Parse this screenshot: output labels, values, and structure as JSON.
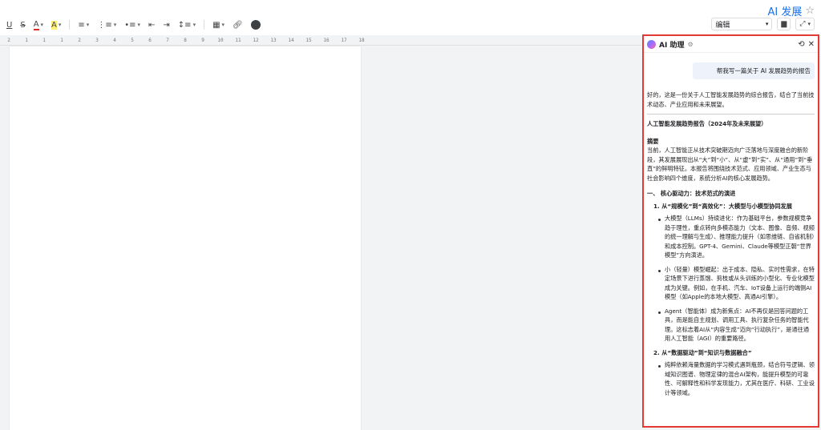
{
  "doc": {
    "title": "AI 发展",
    "mode": "编辑"
  },
  "toolbar": {
    "underline_label": "U",
    "strike_label": "S",
    "text_color_label": "A",
    "highlight_label": "A"
  },
  "ruler": [
    "2",
    "1",
    "1",
    "1",
    "2",
    "3",
    "4",
    "5",
    "6",
    "7",
    "8",
    "9",
    "10",
    "11",
    "12",
    "13",
    "14",
    "15",
    "16",
    "17",
    "18"
  ],
  "ai_panel": {
    "title": "AI 助理",
    "user_message": "帮我写一篇关于 AI 发展趋势的报告",
    "intro": "好的，这是一份关于人工智能发展趋势的综合报告，结合了当前技术动态、产业应用和未来展望。",
    "report_title": "人工智能发展趋势报告（2024年及未来展望）",
    "abstract_heading": "摘要",
    "abstract_text": "当前，人工智能正从技术突破期迈向广泛落地与深度融合的新阶段，其发展展现出从“大”到“小”、从“虚”到“实”、从“通用”到“垂直”的鲜明特征。本报告将围绕技术范式、应用领域、产业生态与社会影响四个维度，系统分析AI的核心发展趋势。",
    "section1": "一、 核心驱动力：技术范式的演进",
    "sub1": "1. 从“规模化”到“高效化”：大模型与小模型协同发展",
    "bullets1": [
      "大模型（LLMs）持续进化：作为基础平台，参数规模竞争趋于理性，重点转向多模态能力（文本、图像、音频、视频的统一理解与生成）、推理能力提升（如思维链、自省机制）和成本控制。GPT-4、Gemini、Claude等模型正朝“世界模型”方向演进。",
      "小（轻量）模型崛起：出于成本、隐私、实时性需求，在特定场景下进行蒸馏、剪枝或从头训练的小型化、专业化模型成为关键。例如，在手机、汽车、IoT设备上运行的端侧AI模型（如Apple的本地大模型、高通AI引擎）。",
      "Agent（智能体）成为新焦点：AI不再仅是回答问题的工具，而是能自主规划、调用工具、执行复杂任务的智能代理。这标志着AI从“内容生成”迈向“行动执行”，是通往通用人工智能（AGI）的重要路径。"
    ],
    "sub2": "2. 从“数据驱动”到“知识与数据融合”",
    "bullets2": [
      "纯粹依赖海量数据的学习模式遇到瓶颈，结合符号逻辑、领域知识图谱、物理定律的混合AI架构，能提升模型的可靠性、可解释性和科学发现能力，尤其在医疗、科研、工业设计等领域。"
    ]
  }
}
